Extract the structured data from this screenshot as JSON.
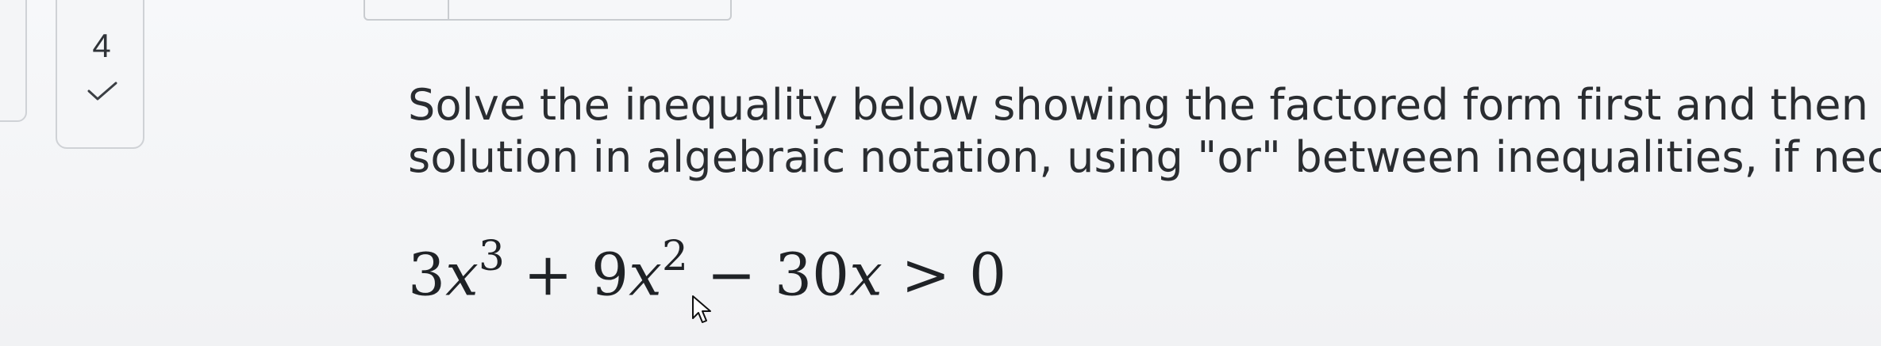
{
  "navigator": {
    "question_number": "4",
    "status_icon": "check-icon"
  },
  "question": {
    "line1": "Solve the inequality below showing the factored form first and then",
    "line2": "solution in algebraic notation, using \"or\" between inequalities, if nec"
  },
  "equation": {
    "c1": "3",
    "v1": "x",
    "e1": "3",
    "op1": " + ",
    "c2": "9",
    "v2": "x",
    "e2": "2",
    "op2": " − ",
    "c3": "30",
    "v3": "x",
    "op3": " > ",
    "rhs": "0"
  },
  "colors": {
    "background": "#f4f5f7",
    "text": "#2a2d31",
    "border": "#cfd2d6"
  }
}
